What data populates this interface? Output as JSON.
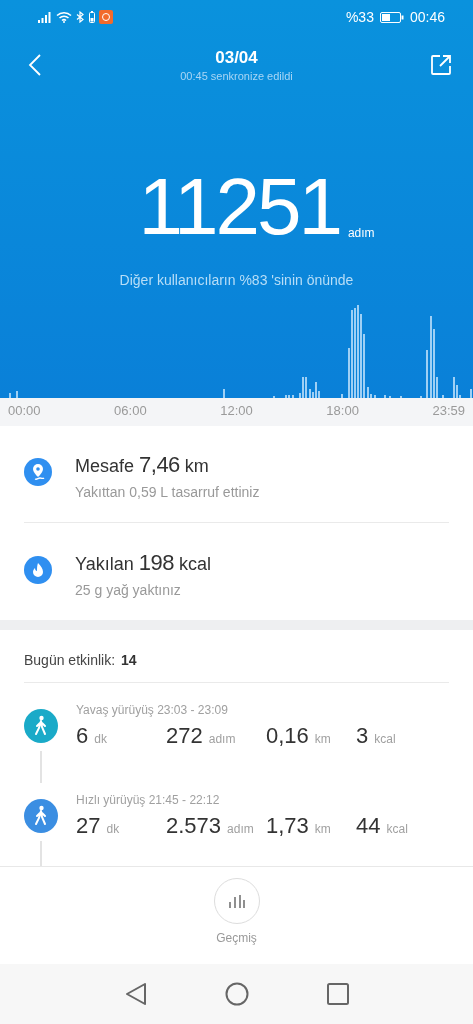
{
  "status_bar": {
    "battery_percent": "%33",
    "time": "00:46"
  },
  "header": {
    "title": "03/04",
    "subtitle": "00:45 senkronize edildi"
  },
  "summary": {
    "steps": "11251",
    "unit": "adım",
    "caption": "Diğer kullanıcıların %83 'sinin önünde"
  },
  "chart_axis": [
    "00:00",
    "06:00",
    "12:00",
    "18:00",
    "23:59"
  ],
  "stats": [
    {
      "kind": "distance",
      "label": "Mesafe",
      "value": "7,46",
      "unit": "km",
      "note": "Yakıttan 0,59 L tasarruf ettiniz"
    },
    {
      "kind": "calories",
      "label": "Yakılan",
      "value": "198",
      "unit": "kcal",
      "note": "25 g yağ yaktınız"
    }
  ],
  "activity": {
    "label": "Bugün etkinlik:",
    "count": "14",
    "items": [
      {
        "title": "Yavaş yürüyüş 23:03 - 23:09",
        "color": "#1aaac8",
        "values": [
          {
            "value": "6",
            "unit": "dk"
          },
          {
            "value": "272",
            "unit": "adım"
          },
          {
            "value": "0,16",
            "unit": "km"
          },
          {
            "value": "3",
            "unit": "kcal"
          }
        ]
      },
      {
        "title": "Hızlı yürüyüş 21:45 - 22:12",
        "color": "#3b8ee2",
        "values": [
          {
            "value": "27",
            "unit": "dk"
          },
          {
            "value": "2.573",
            "unit": "adım"
          },
          {
            "value": "1,73",
            "unit": "km"
          },
          {
            "value": "44",
            "unit": "kcal"
          }
        ]
      }
    ]
  },
  "history_button": {
    "label": "Geçmiş"
  }
}
